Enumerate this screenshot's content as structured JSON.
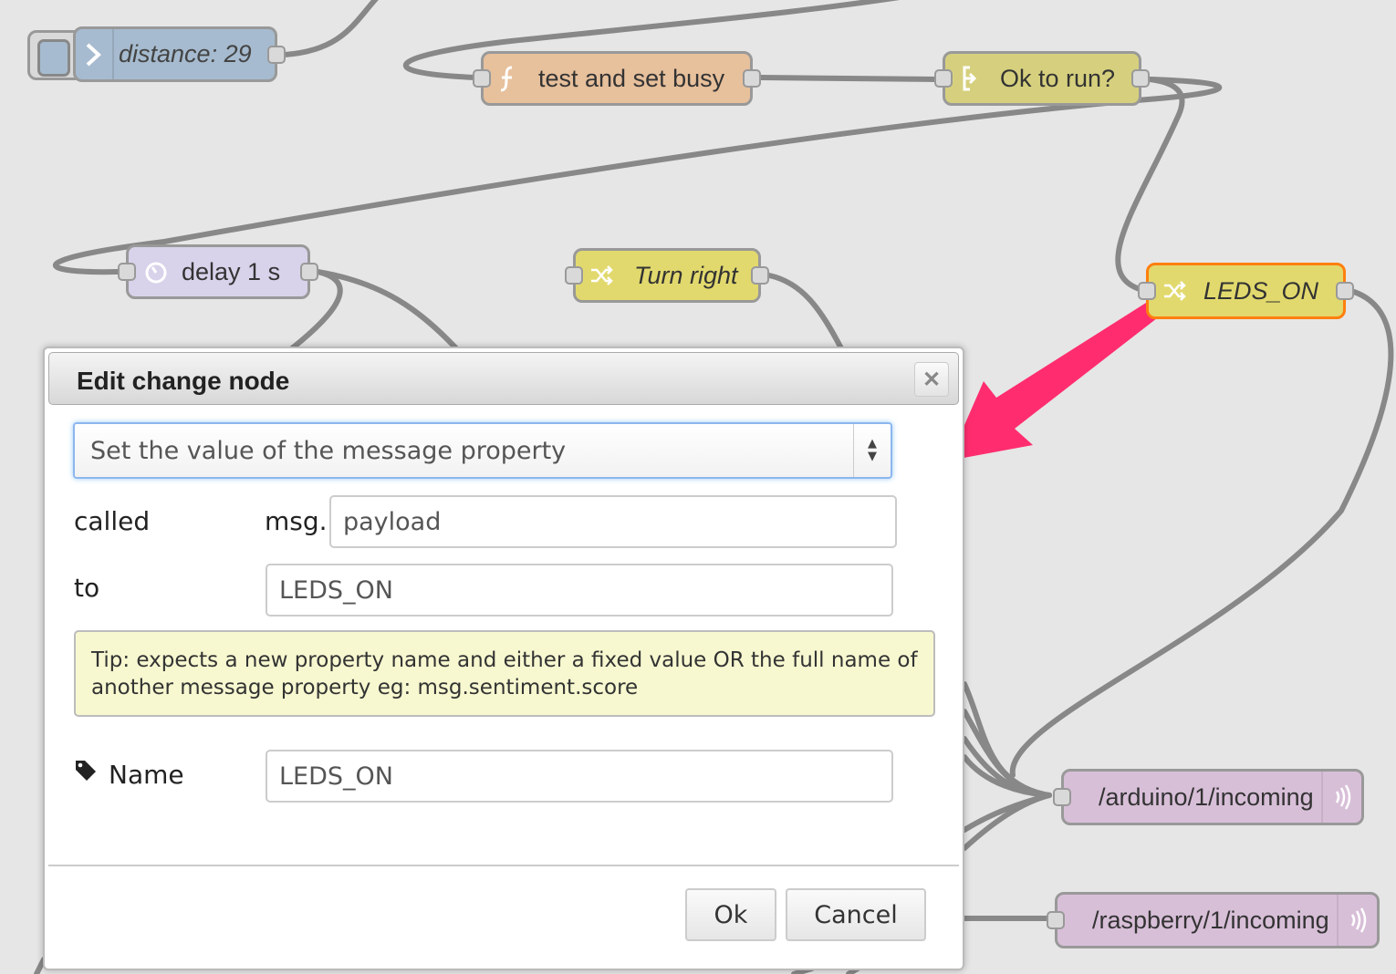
{
  "canvas": {
    "nodes": {
      "distance": {
        "label": "distance: 29",
        "icon": "inject-arrow-icon"
      },
      "test_busy": {
        "label": "test and set busy",
        "icon": "function-icon"
      },
      "ok_to_run": {
        "label": "Ok to run?",
        "icon": "switch-icon"
      },
      "delay": {
        "label": "delay 1 s",
        "icon": "timer-icon"
      },
      "turn_right": {
        "label": "Turn right",
        "icon": "shuffle-icon"
      },
      "leds_on": {
        "label": "LEDS_ON",
        "icon": "shuffle-icon",
        "selected": true
      },
      "arduino": {
        "label": "/arduino/1/incoming",
        "icon": "mqtt-signal-icon"
      },
      "raspberry": {
        "label": "/raspberry/1/incoming",
        "icon": "mqtt-signal-icon"
      }
    },
    "colors": {
      "inject": "#a6bbcf",
      "function": "#e7c09c",
      "switch": "#d6d07e",
      "delay": "#d8d2ea",
      "change": "#e2d96e",
      "mqtt": "#d8bfd8",
      "wire": "#888888",
      "selection": "#ff7f0e",
      "annotation_arrow": "#ff2d6f"
    }
  },
  "dialog": {
    "title": "Edit change node",
    "action_select": "Set the value of the message property",
    "called_label": "called",
    "msg_prefix": "msg.",
    "property_value": "payload",
    "to_label": "to",
    "to_value": "LEDS_ON",
    "tip": "Tip: expects a new property name and either a fixed value OR the full name of another message property eg: msg.sentiment.score",
    "name_label": "Name",
    "name_value": "LEDS_ON",
    "ok_label": "Ok",
    "cancel_label": "Cancel"
  }
}
